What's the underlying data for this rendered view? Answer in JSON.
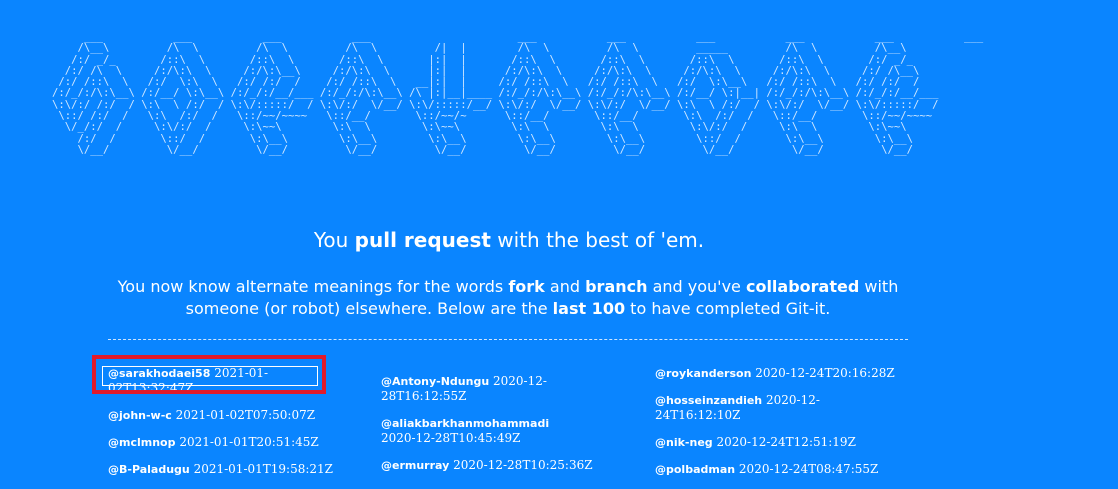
{
  "banner_ascii": "     ___           ___           ___           ___                       ___           ___           ___           ___           ___           ___     \n    /\\__\\         /\\  \\         /\\  \\         /\\  \\         /|  |        /\\  \\         /\\  \\         _____         /\\  \\         /\\__\\    \n   /:/ _/_       /::\\  \\       /::\\  \\       /::\\  \\       |:|  |       /::\\  \\       /::\\  \\       /::\\  \\       /::\\  \\       /:/ _/_   \n  /:/ /\\  \\     /:/\\:\\  \\     /:/\\:\\__\\     /:/\\:\\  \\      |:|  |      /:/\\:\\  \\     /:/\\:\\  \\     /:/\\:\\  \\     /:/\\:\\  \\     /:/ /\\__\\  \n /:/ /::\\  \\   /:/  \\:\\  \\   /:/ /:/  /    /:/ /::\\  \\   __|:|  |     /:/ /::\\  \\   /:/ /::\\  \\   /:/  \\:\\__\\   /:/ /::\\  \\   /:/ /:/  /  \n/:/_/:/\\:\\__\\ /:/__/ \\:\\__\\ /:/_/:/__/___ /:/_/:/\\:\\__\\ /\\ |:|__|____ /:/_/:/\\:\\__\\ /:/_/:/\\:\\__\\ /:/__/ \\:|__| /:/_/:/\\:\\__\\ /:/_/:/__/___\n\\:\\/:/ /:/  / \\:\\  \\ /:/  / \\:\\/:::::/  / \\:\\/:/  \\/__/ \\:\\/:::::/__/ \\:\\/:/  \\/__/ \\:\\/:/  \\/__/ \\:\\  \\ /:/  / \\:\\/:/  \\/__/ \\:\\/:::::/  /\n \\::/ /:/  /   \\:\\  /:/  /   \\::/~~/~~~~   \\::/__/       \\::/~~/~      \\::/__/       \\::/__/       \\:\\  /:/  /   \\::/__/       \\::/~~/~~~~ \n  \\/_/:/  /     \\:\\/:/  /     \\:\\~~\\        \\:\\  \\        \\:\\~~\\        \\:\\  \\        \\:\\  \\        \\:\\/:/  /     \\:\\  \\        \\:\\~~\\     \n    /:/  /       \\::/  /       \\:\\__\\        \\:\\__\\        \\:\\__\\        \\:\\__\\        \\:\\__\\        \\::/  /       \\:\\__\\        \\:\\__\\    \n    \\/__/         \\/__/         \\/__/         \\/__/         \\/__/         \\/__/         \\/__/         \\/__/         \\/__/         \\/__/    ",
  "headline": {
    "pre": "You ",
    "bold": "pull request",
    "post": " with the best of 'em."
  },
  "intro": {
    "t1": "You now know alternate meanings for the words ",
    "b1": "fork",
    "t2": " and ",
    "b2": "branch",
    "t3": " and you've ",
    "b3": "collaborated",
    "t4": " with someone (or robot) elsewhere. Below are the ",
    "b4": "last 100",
    "t5": " to have completed Git-it."
  },
  "completions": {
    "col1": [
      {
        "user": "@sarakhodaei58",
        "time": "2021-01-02T13:32:47Z"
      },
      {
        "user": "@john-w-c",
        "time": "2021-01-02T07:50:07Z"
      },
      {
        "user": "@mclmnop",
        "time": "2021-01-01T20:51:45Z"
      },
      {
        "user": "@B-Paladugu",
        "time": "2021-01-01T19:58:21Z"
      }
    ],
    "col2": [
      {
        "user": "@Antony-Ndungu",
        "time": "2020-12-28T16:12:55Z"
      },
      {
        "user": "@aliakbarkhanmohammadi",
        "time": "2020-12-28T10:45:49Z"
      },
      {
        "user": "@ermurray",
        "time": "2020-12-28T10:25:36Z"
      }
    ],
    "col3": [
      {
        "user": "@roykanderson",
        "time": "2020-12-24T20:16:28Z"
      },
      {
        "user": "@hosseinzandieh",
        "time": "2020-12-24T16:12:10Z"
      },
      {
        "user": "@nik-neg",
        "time": "2020-12-24T12:51:19Z"
      },
      {
        "user": "@polbadman",
        "time": "2020-12-24T08:47:55Z"
      }
    ]
  },
  "colors": {
    "background": "#0a85ff",
    "highlight_border": "#e01a2b"
  }
}
